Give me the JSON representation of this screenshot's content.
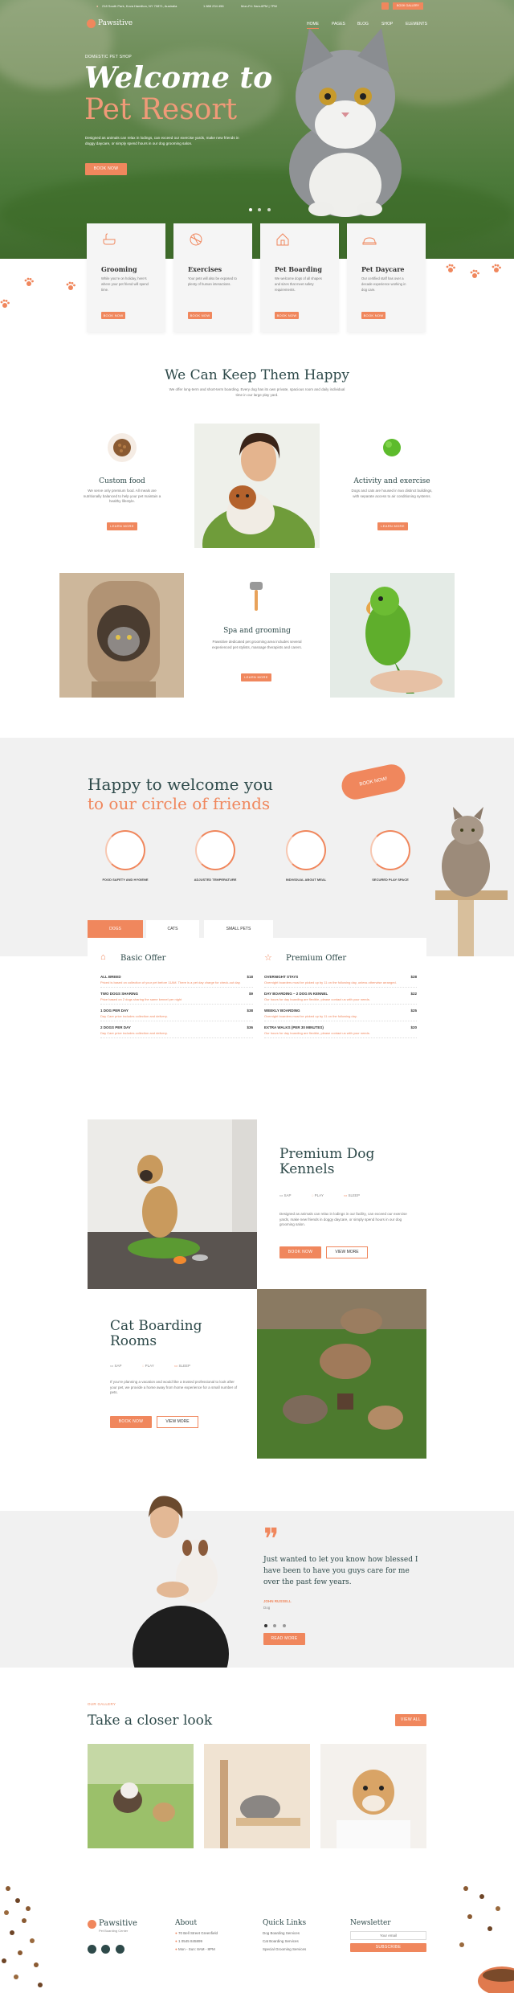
{
  "topbar": {
    "address": "218 South Park, Kova Hamilton, NY 70871, Australia",
    "phone": "1 888 234 456",
    "hours": "Mon-Fri: 9am-6PM | 7PM",
    "cta": "BOOK GALLERY"
  },
  "brand": {
    "name": "Pawsitive"
  },
  "nav": [
    "HOME",
    "PAGES",
    "BLOG",
    "SHOP",
    "ELEMENTS"
  ],
  "hero": {
    "eyebrow": "DOMESTIC PET SHOP",
    "title_line1": "Welcome to",
    "title_line2": "Pet Resort",
    "text": "Designed as animals can relax in lodings, can exceed our exercise yards, make new friends in doggy daycare, or simply spend hours in our dog grooming salon.",
    "button": "BOOK NOW"
  },
  "service_cards": [
    {
      "title": "Grooming",
      "text": "While you’re on holiday, here’s where your pet friend will spend time.",
      "button": "BOOK NOW",
      "icon": "bath-icon"
    },
    {
      "title": "Exercises",
      "text": "Your pets will also be exposed to plenty of human interactions.",
      "button": "BOOK NOW",
      "icon": "ball-icon"
    },
    {
      "title": "Pet Boarding",
      "text": "We welcome dogs of all shapes and sizes that meet safety requirements.",
      "button": "BOOK NOW",
      "icon": "house-icon"
    },
    {
      "title": "Pet Daycare",
      "text": "Our certified staff has over a decade experience working in dog care.",
      "button": "BOOK NOW",
      "icon": "bed-icon"
    }
  ],
  "happy": {
    "title": "We Can Keep Them Happy",
    "text": "We offer long-term and short-term boarding. Every dog has its own private, spacious room and daily individual time in our large play yard.",
    "features": [
      {
        "title": "Custom food",
        "text": "We serve only premium food. All meals are nutritionally balanced to help your pet maintain a healthy lifestyle.",
        "button": "LEARN MORE"
      },
      {
        "title": "Activity and exercise",
        "text": "Dogs and cats are housed in two distinct buildings, with separate access to air conditioning systems.",
        "button": "LEARN MORE"
      },
      {
        "title": "Spa and grooming",
        "text": "Pawsitive dedicated pet grooming area includes several experienced pet stylists, massage therapists and carers.",
        "button": "LEARN MORE"
      }
    ]
  },
  "welcome": {
    "title_line1": "Happy to welcome you",
    "title_line2": "to our circle of friends",
    "badge": "BOOK NOW!",
    "items": [
      "FOOD SAFETY AND HYGIENE",
      "ADJUSTED TEMPERATURE",
      "INDIVIDUAL ABOUT MEAL",
      "SECURED PLAY SPACE"
    ]
  },
  "tabs": [
    "DOGS",
    "CATS",
    "SMALL PETS"
  ],
  "basic_offer": {
    "title": "Basic Offer",
    "rows": [
      {
        "name": "ALL BREED",
        "price": "$18",
        "desc": "Priced is based on collection of your pet before 11AM. There is a pet day charge for check-out day."
      },
      {
        "name": "TWO DOGS SHARING",
        "price": "$9",
        "desc": "Price based on 2 dogs sharing the same kennel per night"
      },
      {
        "name": "1 DOG PER DAY",
        "price": "$38",
        "desc": "Day Care price includes collection and delivery."
      },
      {
        "name": "2 DOGS PER DAY",
        "price": "$36",
        "desc": "Day Care price includes collection and delivery."
      }
    ]
  },
  "premium_offer": {
    "title": "Premium Offer",
    "rows": [
      {
        "name": "OVERNIGHT STAYS",
        "price": "$28",
        "desc": "Overnight boarders must be picked up by 11 on the following day, unless otherwise arranged."
      },
      {
        "name": "DAY BOARDING – 2 DOG IN KENNEL",
        "price": "$22",
        "desc": "Our hours for day boarding are flexible, please contact us with your needs."
      },
      {
        "name": "WEEKLY BOARDING",
        "price": "$25",
        "desc": "Overnight boarders must be picked up by 11 on the following day."
      },
      {
        "name": "EXTRA WALKS (PER 30 MINUTES)",
        "price": "$20",
        "desc": "Our hours for day boarding are flexible, please contact us with your needs."
      }
    ]
  },
  "kennels": {
    "title_line1": "Premium Dog",
    "title_line2": "Kennels",
    "meta": [
      "SAP",
      "PLAY",
      "SLEEP"
    ],
    "text": "Designed as animals can relax in lodings in our facility, can exceed our exercise yards, make new friends in doggy daycare, or simply spend hours in our dog grooming salon.",
    "btn_primary": "BOOK NOW",
    "btn_secondary": "VIEW MORE"
  },
  "cat_rooms": {
    "title_line1": "Cat Boarding",
    "title_line2": "Rooms",
    "meta": [
      "SAP",
      "PLAY",
      "SLEEP"
    ],
    "text": "If you’re planning a vacation and would like a trusted professional to look after your pet, we provide a home away from home experience for a small number of pets.",
    "btn_primary": "BOOK NOW",
    "btn_secondary": "VIEW MORE"
  },
  "testimonial": {
    "quote": "Just wanted to let you know how blessed I have been to have you guys care for me over the past few years.",
    "author": "JOHN RUSSELL",
    "role": "Dog",
    "button": "READ MORE"
  },
  "gallery": {
    "eyebrow": "OUR GALLERY",
    "title": "Take a closer look",
    "button": "VIEW ALL"
  },
  "footer": {
    "brand": "Pawsitive",
    "tagline": "Pet Boarding Center",
    "about_title": "About",
    "about_items": [
      "70 Bell Street Greenfield",
      "1 0545 845899",
      "Mon - Sun: 8AM - 8PM"
    ],
    "links_title": "Quick Links",
    "links": [
      "Dog Boarding Services",
      "Cat Boarding Services",
      "Special Grooming Services"
    ],
    "newsletter_title": "Newsletter",
    "newsletter_placeholder": "Your email",
    "newsletter_button": "SUBSCRIBE"
  },
  "colors": {
    "accent": "#f0875d",
    "heading": "#2e4a4a"
  }
}
